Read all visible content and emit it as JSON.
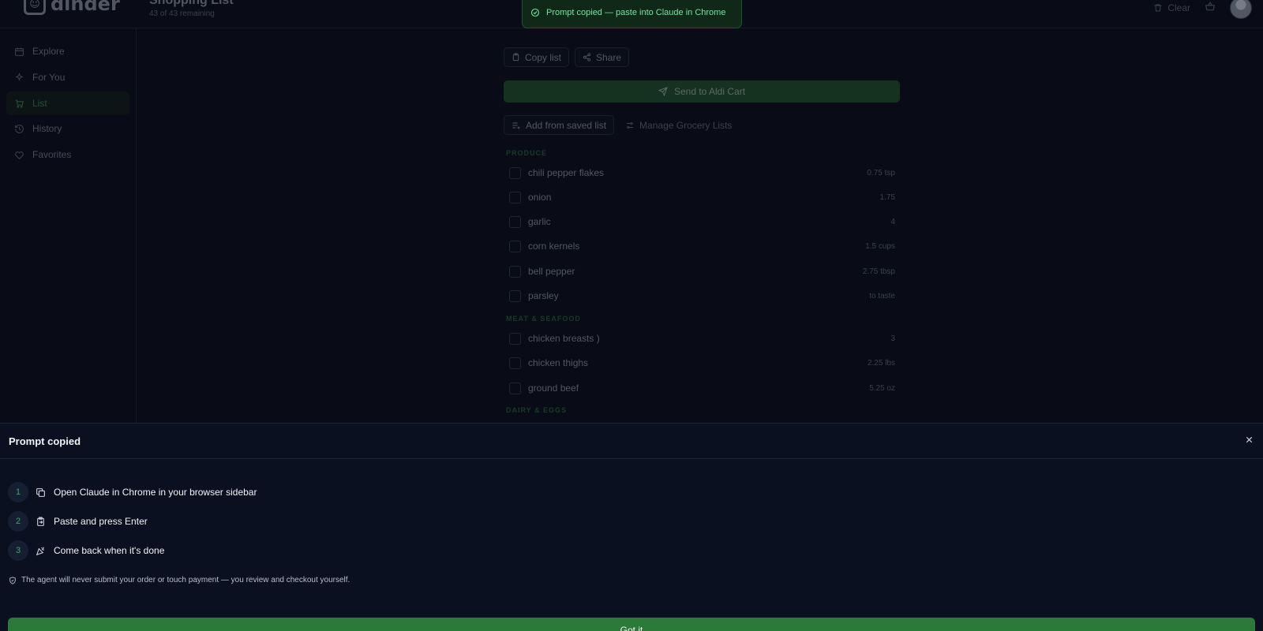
{
  "app": {
    "logo_text": "dinder"
  },
  "header": {
    "title": "Shopping List",
    "subtitle": "43 of 43 remaining",
    "clear_label": "Clear"
  },
  "sidebar": {
    "items": [
      {
        "label": "Explore",
        "icon": "calendar-icon"
      },
      {
        "label": "For You",
        "icon": "sparkles-icon"
      },
      {
        "label": "List",
        "icon": "cart-icon",
        "active": true
      },
      {
        "label": "History",
        "icon": "history-icon"
      },
      {
        "label": "Favorites",
        "icon": "heart-icon"
      }
    ]
  },
  "toolbar": {
    "copy_list": "Copy list",
    "share": "Share",
    "send_to_cart": "Send to Aldi Cart",
    "add_from_saved": "Add from saved list",
    "manage_lists": "Manage Grocery Lists"
  },
  "sections": [
    {
      "label": "PRODUCE",
      "items": [
        {
          "name": "chili pepper flakes",
          "qty": "0.75 tsp"
        },
        {
          "name": "onion",
          "qty": "1.75"
        },
        {
          "name": "garlic",
          "qty": "4"
        },
        {
          "name": "corn kernels",
          "qty": "1.5 cups"
        },
        {
          "name": "bell pepper",
          "qty": "2.75 tbsp"
        },
        {
          "name": "parsley",
          "qty": "to taste"
        }
      ]
    },
    {
      "label": "MEAT & SEAFOOD",
      "items": [
        {
          "name": "chicken breasts )",
          "qty": "3"
        },
        {
          "name": "chicken thighs",
          "qty": "2.25 lbs"
        },
        {
          "name": "ground beef",
          "qty": "5.25 oz"
        }
      ]
    },
    {
      "label": "DAIRY & EGGS",
      "items": []
    }
  ],
  "toast": {
    "message": "Prompt copied — paste into Claude in Chrome"
  },
  "sheet": {
    "title": "Prompt copied",
    "steps": [
      {
        "num": "1",
        "text": "Open Claude in Chrome in your browser sidebar",
        "icon": "copy-icon"
      },
      {
        "num": "2",
        "text": "Paste and press Enter",
        "icon": "clipboard-icon"
      },
      {
        "num": "3",
        "text": "Come back when it's done",
        "icon": "party-popper-icon"
      }
    ],
    "disclaimer": "The agent will never submit your order or touch payment — you review and checkout yourself.",
    "button": "Got it"
  },
  "colors": {
    "accent": "#2b7a3a",
    "toast_text": "#6ee7a0",
    "background": "#0b0f1a"
  }
}
